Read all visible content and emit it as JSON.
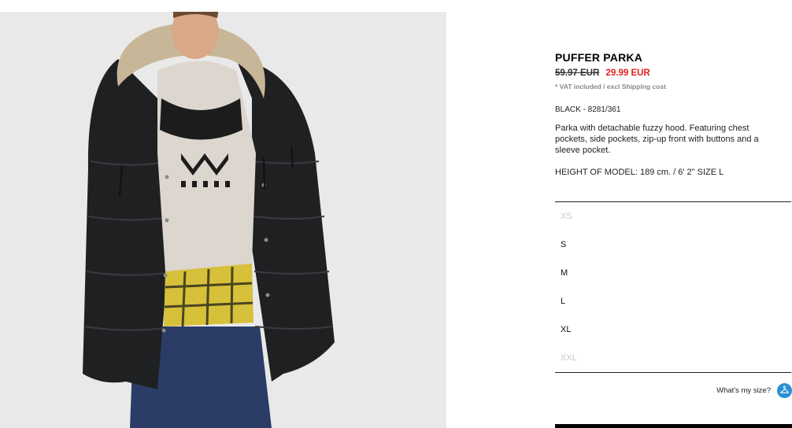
{
  "product": {
    "title": "PUFFER PARKA",
    "old_price": "59.97 EUR",
    "new_price": "29.99 EUR",
    "vat_note": "* VAT included / excl Shipping cost",
    "color_ref": "BLACK - 8281/361",
    "description": "Parka with detachable fuzzy hood. Featuring chest pockets, side pockets, zip-up front with buttons and a sleeve pocket.",
    "model_info": "HEIGHT OF MODEL: 189 cm. / 6' 2\" SIZE L"
  },
  "sizes": [
    {
      "label": "XS",
      "available": false
    },
    {
      "label": "S",
      "available": true
    },
    {
      "label": "M",
      "available": true
    },
    {
      "label": "L",
      "available": true
    },
    {
      "label": "XL",
      "available": true
    },
    {
      "label": "XXL",
      "available": false
    }
  ],
  "size_guide": {
    "label": "What's my size?",
    "icon": "hanger-icon"
  },
  "colors": {
    "sale": "#e0211f",
    "accent": "#2a8fd6",
    "disabled": "#c8c8c8"
  }
}
